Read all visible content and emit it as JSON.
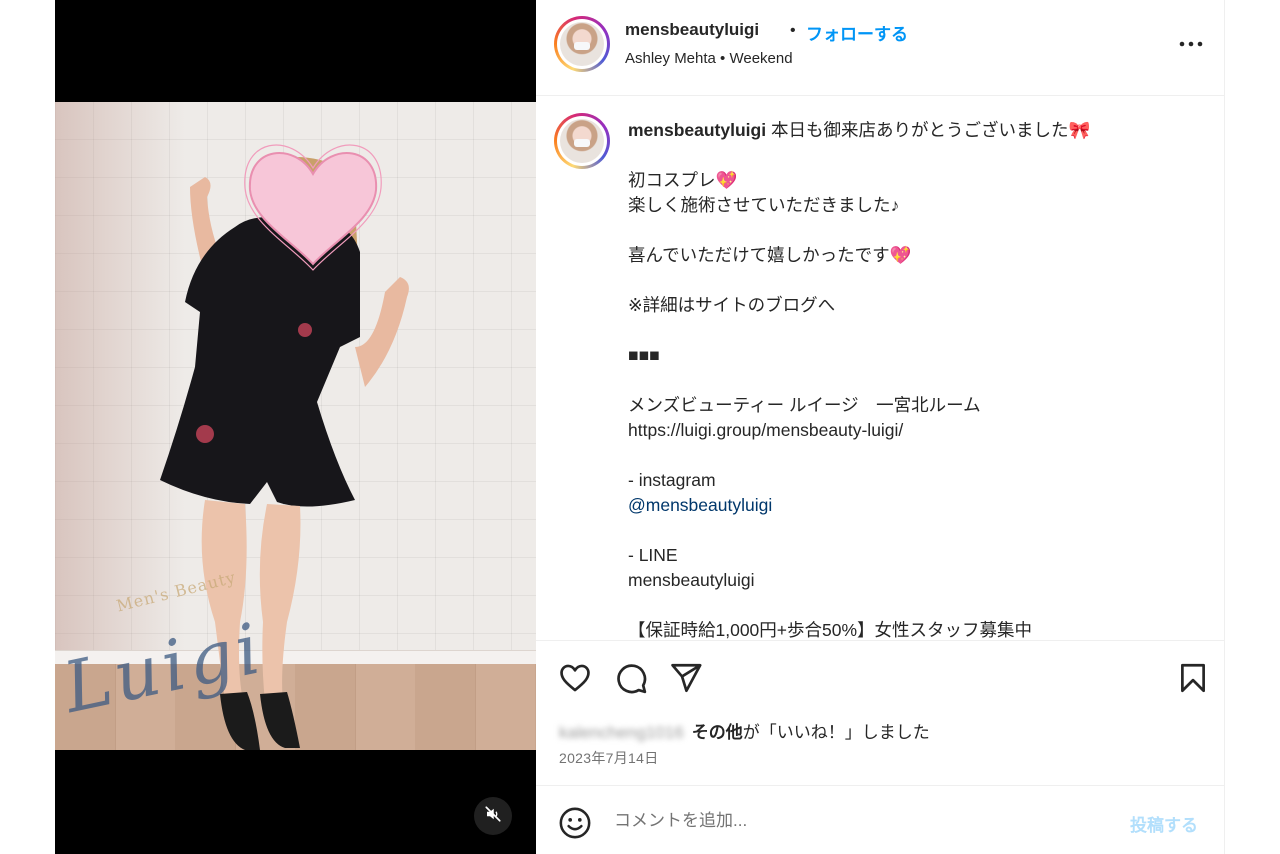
{
  "header": {
    "username": "mensbeautyluigi",
    "separator": "•",
    "follow_label": "フォローする",
    "subtitle": "Ashley Mehta • Weekend",
    "more_icon": "more-horizontal-icon"
  },
  "caption": {
    "username": "mensbeautyluigi",
    "line_first": " 本日も御来店ありがとうございました🎀",
    "body_1": "\n\n初コスプレ💖\n楽しく施術させていただきました♪\n\n喜んでいただけて嬉しかったです💖\n\n※詳細はサイトのブログへ\n\n■■■\n\nメンズビューティー ルイージ　一宮北ルーム\nhttps://luigi.group/mensbeauty-luigi/\n\n- instagram\n",
    "mention": "@mensbeautyluigi",
    "body_2": "\n\n- LINE\nmensbeautyluigi\n\n【保証時給1,000円+歩合50%】女性スタッフ募集中"
  },
  "media": {
    "watermark": "Men's Beauty",
    "script_logo": "Luigi",
    "mute_icon": "speaker-muted-icon"
  },
  "actions": {
    "icons": [
      "heart-icon",
      "comment-icon",
      "share-icon",
      "bookmark-icon"
    ],
    "liked_by_blurred": "kalencheng1016",
    "liked_others": "その他",
    "liked_suffix": "が「いいね！」しました",
    "date": "2023年7月14日"
  },
  "comment": {
    "emoji_icon": "emoji-smile-icon",
    "placeholder": "コメントを追加...",
    "post_label": "投稿する"
  },
  "colors": {
    "accent": "#0095f6",
    "mention": "#00376b",
    "post_disabled": "#b2dffc"
  }
}
